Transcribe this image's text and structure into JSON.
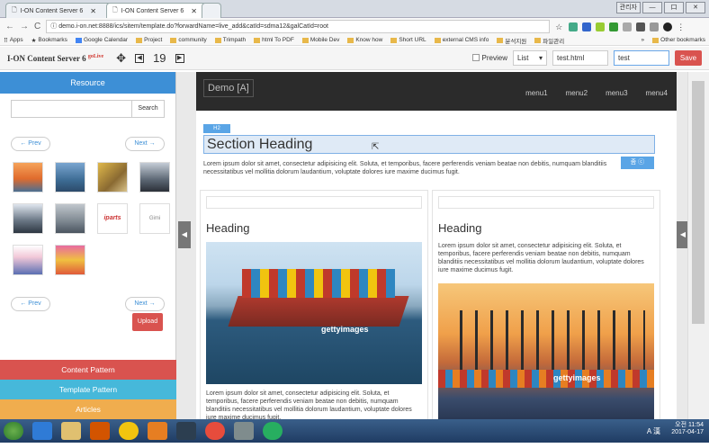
{
  "browser": {
    "tabs": [
      {
        "label": "I-ON Content Server 6"
      },
      {
        "label": "I-ON Content Server 6"
      }
    ],
    "window_controls": {
      "user": "관리자",
      "minimize": "—",
      "maximize": "口",
      "close": "✕"
    },
    "url": "demo.i-on.net:8888/ics/sitem/template.do?forwardName=live_add&catId=sdma12&galCatId=root",
    "bookmarks": [
      "Apps",
      "Bookmarks",
      "Google Calendar",
      "Project",
      "community",
      "Trimpath",
      "html To PDF",
      "Mobile Dev",
      "Know how",
      "Short URL",
      "external CMS info",
      "분석지원",
      "파일관리"
    ],
    "other_bookmarks": "Other bookmarks",
    "bookmarks_more": "»"
  },
  "app_toolbar": {
    "brand": "I-ON Content Server 6",
    "brand_badge": "goLive",
    "page_number": "19",
    "preview_label": "Preview",
    "view_select": "List",
    "template_file": "test.html",
    "name_input": "test",
    "save_label": "Save"
  },
  "left_panel": {
    "resource_label": "Resource",
    "search_button": "Search",
    "prev_label": "← Prev",
    "next_label": "Next →",
    "upload_label": "Upload",
    "thumb_texts": [
      "iparts",
      "Gimi"
    ],
    "footer": [
      {
        "label": "Content Pattern",
        "color": "#d9534f"
      },
      {
        "label": "Template Pattern",
        "color": "#46b8da"
      },
      {
        "label": "Articles",
        "color": "#f0ad4e"
      }
    ]
  },
  "site": {
    "logo": "Demo [A]",
    "menu": [
      "menu1",
      "menu2",
      "menu3",
      "menu4"
    ],
    "h2_tag": "H2",
    "section_heading": "Section Heading",
    "edit_tag": "좀 ⓒ",
    "section_paragraph": "Lorem ipsum dolor sit amet, consectetur adipisicing elit. Soluta, et temporibus, facere perferendis veniam beatae non debitis, numquam blanditiis necessitatibus vel mollitia dolorum laudantium, voluptate dolores iure maxime ducimus fugit.",
    "columns": [
      {
        "heading": "Heading",
        "paragraph": "Lorem ipsum dolor sit amet, consectetur adipisicing elit. Soluta, et temporibus, facere perferendis veniam beatae non debitis, numquam blanditiis necessitatibus vel mollitia dolorum laudantium, voluptate dolores iure maxime ducimus fugit.",
        "image_credit": "gettyimages"
      },
      {
        "heading": "Heading",
        "paragraph": "Lorem ipsum dolor sit amet, consectetur adipisicing elit. Soluta, et temporibus, facere perferendis veniam beatae non debitis, numquam blanditiis necessitatibus vel mollitia dolorum laudantium, voluptate dolores iure maxime ducimus fugit.",
        "image_credit": "gettyimages"
      }
    ]
  },
  "taskbar": {
    "time": "오전 11:54",
    "date": "2017-04-17",
    "ime": "A 漢"
  }
}
